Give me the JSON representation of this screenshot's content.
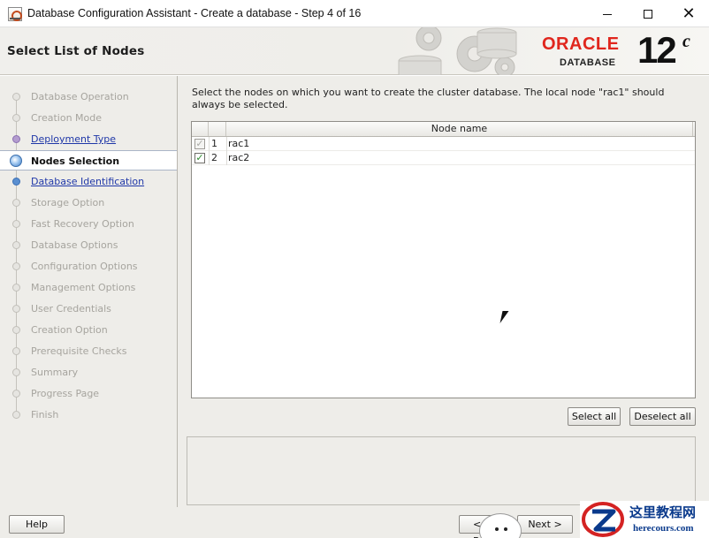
{
  "window": {
    "title": "Database Configuration Assistant - Create a database - Step 4 of 16",
    "minimize": "—",
    "maximize": "☐",
    "close": "✕"
  },
  "header": {
    "page_title": "Select List of Nodes",
    "brand": "ORACLE",
    "product": "DATABASE",
    "version": "12",
    "version_suffix": "c"
  },
  "sidebar": {
    "steps": [
      {
        "label": "Database Operation",
        "state": "disabled"
      },
      {
        "label": "Creation Mode",
        "state": "disabled"
      },
      {
        "label": "Deployment Type",
        "state": "link"
      },
      {
        "label": "Nodes Selection",
        "state": "current"
      },
      {
        "label": "Database Identification",
        "state": "link"
      },
      {
        "label": "Storage Option",
        "state": "disabled"
      },
      {
        "label": "Fast Recovery Option",
        "state": "disabled"
      },
      {
        "label": "Database Options",
        "state": "disabled"
      },
      {
        "label": "Configuration Options",
        "state": "disabled"
      },
      {
        "label": "Management Options",
        "state": "disabled"
      },
      {
        "label": "User Credentials",
        "state": "disabled"
      },
      {
        "label": "Creation Option",
        "state": "disabled"
      },
      {
        "label": "Prerequisite Checks",
        "state": "disabled"
      },
      {
        "label": "Summary",
        "state": "disabled"
      },
      {
        "label": "Progress Page",
        "state": "disabled"
      },
      {
        "label": "Finish",
        "state": "disabled"
      }
    ]
  },
  "main": {
    "instructions": "Select the nodes on which you want to create the cluster database. The local node \"rac1\" should always be selected.",
    "table": {
      "columns": [
        "",
        "",
        "Node name"
      ],
      "rows": [
        {
          "num": "1",
          "name": "rac1",
          "checked": true,
          "enabled": false
        },
        {
          "num": "2",
          "name": "rac2",
          "checked": true,
          "enabled": true
        }
      ]
    },
    "select_all": "Select all",
    "deselect_all": "Deselect all"
  },
  "footer": {
    "help": "Help",
    "back": "< Back",
    "next": "Next >"
  },
  "watermark": {
    "title": "这里教程网",
    "url": "herecours.com"
  },
  "colors": {
    "oracle_red": "#e0261d",
    "link_blue": "#1f37a8",
    "check_green": "#2c8a2c"
  }
}
